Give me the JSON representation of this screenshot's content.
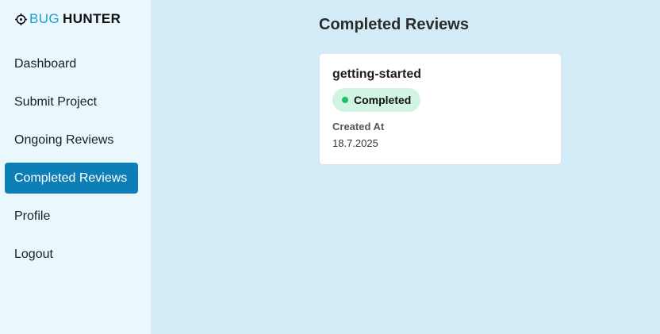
{
  "logo": {
    "part1": "BUG",
    "part2": "HUNTER",
    "icon": "crosshair-icon"
  },
  "nav": {
    "items": [
      {
        "label": "Dashboard"
      },
      {
        "label": "Submit Project"
      },
      {
        "label": "Ongoing Reviews"
      },
      {
        "label": "Completed Reviews"
      },
      {
        "label": "Profile"
      },
      {
        "label": "Logout"
      }
    ],
    "active_index": 3
  },
  "main": {
    "title": "Completed Reviews",
    "cards": [
      {
        "title": "getting-started",
        "status": "Completed",
        "created_label": "Created At",
        "created_value": "18.7.2025"
      }
    ]
  },
  "colors": {
    "sidebar_bg": "#eaf7fd",
    "main_bg": "#d4ecf8",
    "accent": "#0d7fb6",
    "logo_blue": "#1ba1cf",
    "badge_bg": "#d1f5e2",
    "badge_dot": "#1fbf6c"
  }
}
